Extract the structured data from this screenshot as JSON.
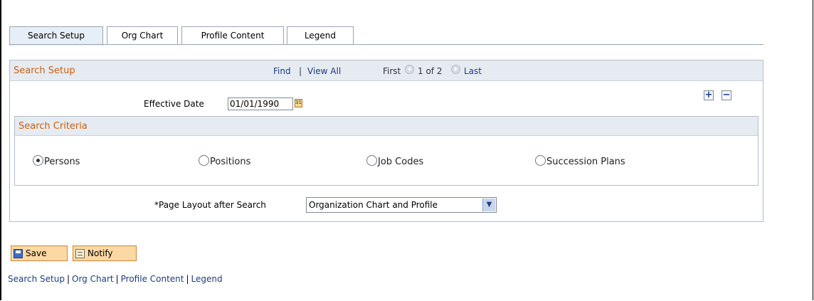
{
  "tabs": [
    {
      "label": "Search Setup",
      "active": true
    },
    {
      "label": "Org Chart",
      "active": false
    },
    {
      "label": "Profile Content",
      "active": false
    },
    {
      "label": "Legend",
      "active": false
    }
  ],
  "section": {
    "title": "Search Setup",
    "find": "Find",
    "view_all": "View All",
    "first": "First",
    "pager": "1 of 2",
    "last": "Last",
    "effective_date_label": "Effective Date",
    "effective_date_value": "01/01/1990",
    "add_row": "+",
    "delete_row": "−"
  },
  "criteria": {
    "title": "Search Criteria",
    "options": [
      "Persons",
      "Positions",
      "Job Codes",
      "Succession Plans"
    ],
    "selected": "Persons"
  },
  "layout_select": {
    "label": "*Page Layout after Search",
    "value": "Organization Chart and Profile"
  },
  "buttons": {
    "save": "Save",
    "notify": "Notify"
  },
  "footer_links": [
    "Search Setup",
    "Org Chart",
    "Profile Content",
    "Legend"
  ],
  "colors": {
    "section_title": "#c66010",
    "link": "#1f3b80",
    "header_bg": "#e6ebf2",
    "button_bg": "#fbd8a4"
  }
}
